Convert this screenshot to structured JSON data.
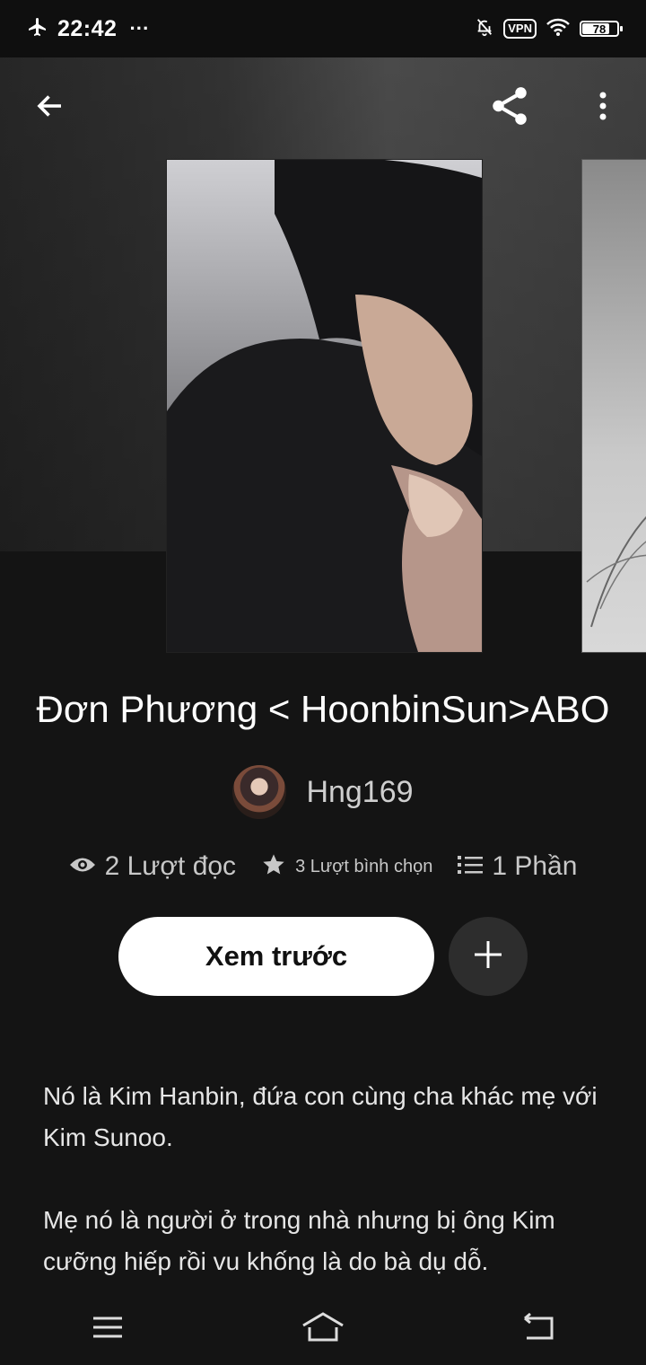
{
  "status_bar": {
    "time": "22:42",
    "dots": "···",
    "vpn": "VPN",
    "battery": "78",
    "battery_level": 0.78
  },
  "header": {
    "back_icon": "arrow-left-icon",
    "share_icon": "share-icon",
    "more_icon": "more-vert-icon"
  },
  "story": {
    "title": "Đơn Phương < HoonbinSun>ABO",
    "author": "Hng169",
    "stats": {
      "reads": "2 Lượt đọc",
      "votes": "3 Lượt bình chọn",
      "parts": "1 Phần"
    },
    "preview_label": "Xem trước",
    "description": [
      "Nó là Kim Hanbin, đứa con cùng cha khác mẹ với Kim Sunoo.",
      "Mẹ nó là người ở trong nhà nhưng bị ông Kim cưỡng hiếp rồi vu khống là do bà dụ dỗ."
    ]
  },
  "nav": {
    "menu_icon": "menu-icon",
    "home_icon": "home-icon",
    "back_icon": "back-icon"
  },
  "colors": {
    "background": "#141414",
    "button_bg": "#ffffff",
    "add_button_bg": "#2d2d2d"
  }
}
